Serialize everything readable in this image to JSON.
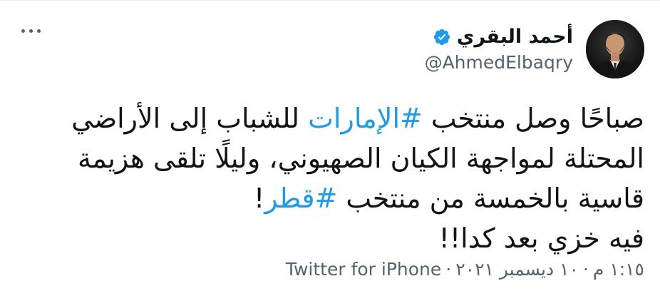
{
  "tweet": {
    "author": {
      "display_name": "أحمد البقري",
      "handle": "@AhmedElbaqry",
      "verified": true,
      "verified_icon": "verified-badge-icon"
    },
    "more_icon": "more-horizontal-icon",
    "body": {
      "line1_before": "صباحًا وصل منتخب ",
      "line1_hashtag": "#الإمارات",
      "line1_after": " للشباب إلى الأراضي",
      "line2": "المحتلة لمواجهة الكيان الصهيوني، وليلًا تلقى هزيمة",
      "line3_before": "قاسية بالخمسة من منتخب ",
      "line3_hashtag": "#قطر",
      "line3_after": "!",
      "line4": "فيه خزي بعد كدا!!"
    },
    "meta": {
      "time": "١:١٥ م",
      "date": "١٠ ديسمبر ٢٠٢١",
      "separator": "·",
      "source": "Twitter for iPhone"
    },
    "colors": {
      "text": "#0f1419",
      "secondary": "#536471",
      "hashtag": "#1d9bf0",
      "verified": "#1d9bf0"
    }
  }
}
